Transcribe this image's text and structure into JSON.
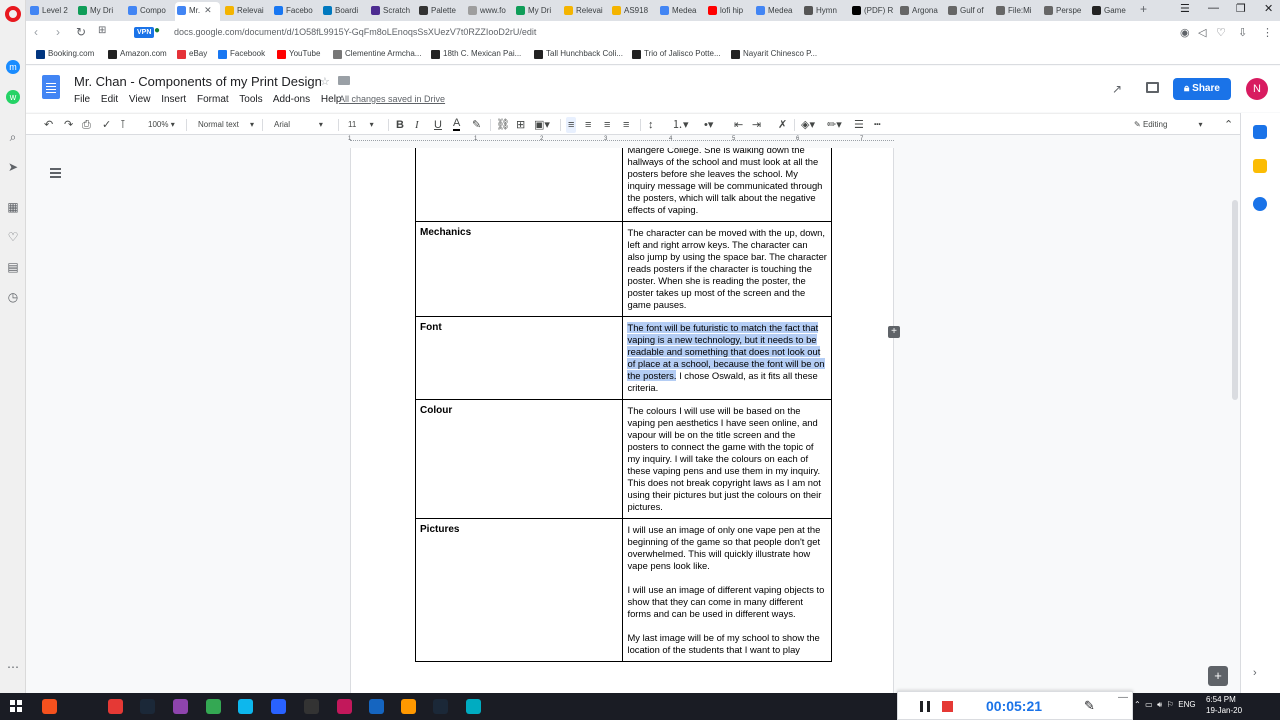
{
  "browser": {
    "tabs": [
      {
        "label": "Level 2",
        "color": "#4285f4"
      },
      {
        "label": "My Dri",
        "color": "#0f9d58"
      },
      {
        "label": "Compo",
        "color": "#4285f4"
      },
      {
        "label": "Mr.",
        "color": "#4285f4"
      },
      {
        "label": "Relevai",
        "color": "#f4b400"
      },
      {
        "label": "Facebo",
        "color": "#1877f2"
      },
      {
        "label": "Boardi",
        "color": "#0079bf"
      },
      {
        "label": "Scratch",
        "color": "#4d2c91"
      },
      {
        "label": "Palette",
        "color": "#333333"
      },
      {
        "label": "www.fo",
        "color": "#9e9e9e"
      },
      {
        "label": "My Dri",
        "color": "#0f9d58"
      },
      {
        "label": "Relevai",
        "color": "#f4b400"
      },
      {
        "label": "AS918",
        "color": "#f4b400"
      },
      {
        "label": "Medea",
        "color": "#4285f4"
      },
      {
        "label": "lofi hip",
        "color": "#ff0000"
      },
      {
        "label": "Medea",
        "color": "#4285f4"
      },
      {
        "label": "Hymn",
        "color": "#555555"
      },
      {
        "label": "(PDF) R",
        "color": "#000000"
      },
      {
        "label": "Argona",
        "color": "#666666"
      },
      {
        "label": "Gulf of",
        "color": "#666666"
      },
      {
        "label": "File:Mi",
        "color": "#666666"
      },
      {
        "label": "Perspe",
        "color": "#666666"
      },
      {
        "label": "Game",
        "color": "#222222"
      }
    ],
    "new_tab": "+",
    "vpn": "VPN",
    "url": "docs.google.com/document/d/1O58fL9915Y-GqFm8oLEnoqsSsXUezV7t0RZZIooD2rU/edit",
    "bookmarks": [
      {
        "label": "Booking.com",
        "color": "#003580"
      },
      {
        "label": "Amazon.com",
        "color": "#222222"
      },
      {
        "label": "eBay",
        "color": "#e53238"
      },
      {
        "label": "Facebook",
        "color": "#1877f2"
      },
      {
        "label": "YouTube",
        "color": "#ff0000"
      },
      {
        "label": "Clementine Armcha...",
        "color": "#777777"
      },
      {
        "label": "18th C. Mexican Pai...",
        "color": "#222222"
      },
      {
        "label": "Tall Hunchback Coli...",
        "color": "#222222"
      },
      {
        "label": "Trio of Jalisco Potte...",
        "color": "#222222"
      },
      {
        "label": "Nayarit Chinesco P...",
        "color": "#222222"
      }
    ]
  },
  "docs": {
    "title": "Mr. Chan - Components of my Print Design",
    "menu": [
      "File",
      "Edit",
      "View",
      "Insert",
      "Format",
      "Tools",
      "Add-ons",
      "Help"
    ],
    "saved_status": "All changes saved in Drive",
    "share_label": "Share",
    "avatar_initial": "N",
    "toolbar": {
      "zoom": "100%",
      "style": "Normal text",
      "font": "Arial",
      "size": "11",
      "editing": "Editing"
    },
    "ruler_numbers": [
      "1",
      "1",
      "2",
      "3",
      "4",
      "5",
      "6",
      "7"
    ]
  },
  "table": {
    "rows": [
      {
        "label": "",
        "paragraphs": [
          "Mangere College. She is walking down the hallways of the school and must look at all the posters before she leaves the school. My inquiry message will be communicated through the posters, which will talk about the negative effects of vaping."
        ]
      },
      {
        "label": "Mechanics",
        "paragraphs": [
          "The character can be moved with the up, down, left and right arrow keys. The character can also jump by using the space bar. The character reads posters if the character is touching the poster. When she is reading the poster, the poster takes up most of the screen and the game pauses."
        ]
      },
      {
        "label": "Font",
        "selected": "The font will be futuristic to match the fact that vaping is a new technology, but it needs to be readable and something that does not look out of place at a school, because the font will be on the posters.",
        "rest": " I chose Oswald, as it fits all these criteria."
      },
      {
        "label": "Colour",
        "paragraphs": [
          "The colours I will use will be based on the vaping pen aesthetics I have seen online, and vapour will be on the title screen and the posters to connect the game with the topic of my inquiry. I will take the colours on each of these vaping pens and use them in my inquiry. This does not break copyright laws as I am not using their pictures but just the colours on their pictures."
        ]
      },
      {
        "label": "Pictures",
        "paragraphs": [
          "I will use an image of only one vape pen at the beginning of the game so that people don't get overwhelmed. This will quickly illustrate how vape pens look like.",
          "I will use an image of different vaping objects to show that they can come in many different forms and can be used in different ways.",
          "My last image will be of my school to show the location of the students that I want to play"
        ]
      }
    ]
  },
  "recorder": {
    "time": "00:05:21"
  },
  "taskbar": {
    "lang": "ENG",
    "time": "6:54 PM",
    "date": "19-Jan-20",
    "icons": [
      "#f4511e",
      "#e53935",
      "#1b2838",
      "#8e44ad",
      "#34a853",
      "#0db7ed",
      "#2962ff",
      "#333333",
      "#c2185b",
      "#1565c0",
      "#ff9800",
      "#1b2838",
      "#00acc1"
    ]
  }
}
